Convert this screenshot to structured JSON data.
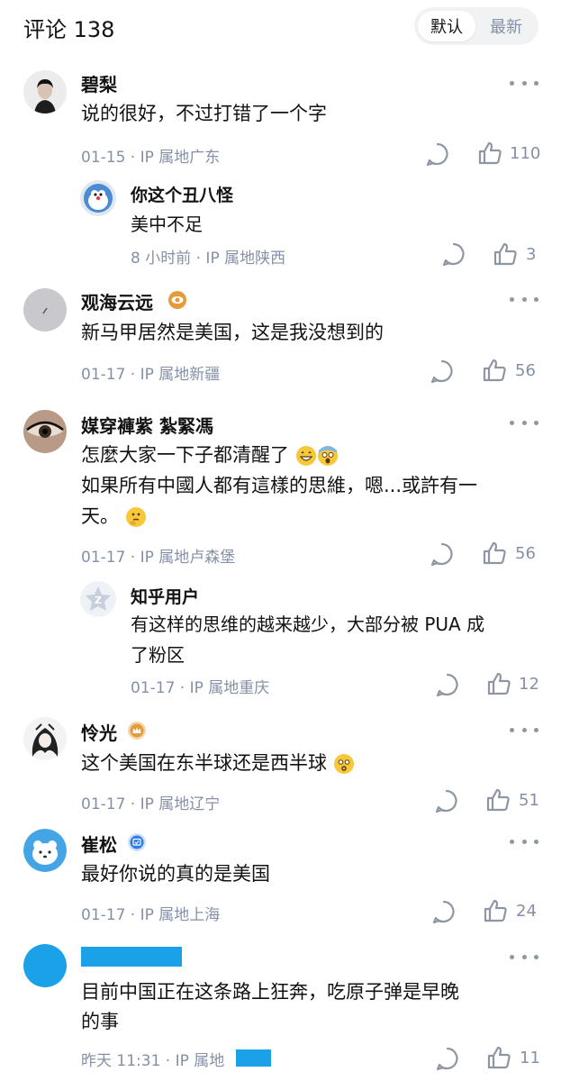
{
  "header": {
    "title": "评论 138",
    "sort_default": "默认",
    "sort_latest": "最新"
  },
  "colors": {
    "text_primary": "#121212",
    "text_secondary": "#8590a6",
    "redaction_blue": "#1ba1e8",
    "badge_orange": "#e59a3c",
    "badge_blue": "#2d7de6"
  },
  "comments": [
    {
      "name": "碧梨",
      "text": "说的很好，不过打错了一个字",
      "meta": "01-15 · IP 属地广东",
      "likes": "110"
    },
    {
      "name": "你这个丑八怪",
      "text": "美中不足",
      "meta": "8 小时前 · IP 属地陕西",
      "likes": "3"
    },
    {
      "name": "观海云远",
      "badge": "eye-badge-icon",
      "text": "新马甲居然是美国，这是我没想到的",
      "meta": "01-17 · IP 属地新疆",
      "likes": "56"
    },
    {
      "name": "媒穿褲紫 紮緊馮",
      "text_line1": "怎麼大家一下子都清醒了",
      "text_line2": "如果所有中國人都有這樣的思維，嗯...或許有一",
      "text_line3": "天。",
      "meta": "01-17 · IP 属地卢森堡",
      "likes": "56"
    },
    {
      "name": "知乎用户",
      "text_line1": "有这样的思维的越来越少，大部分被 PUA 成",
      "text_line2": "了粉区",
      "meta": "01-17 · IP 属地重庆",
      "likes": "12"
    },
    {
      "name": "怜光",
      "badge": "crown-badge-icon",
      "text": "这个美国在东半球还是西半球",
      "meta": "01-17 · IP 属地辽宁",
      "likes": "51"
    },
    {
      "name": "崔松",
      "badge": "verified-badge-icon",
      "text": "最好你说的真的是美国",
      "meta": "01-17 · IP 属地上海",
      "likes": "24"
    },
    {
      "text_line1": "目前中国正在这条路上狂奔，吃原子弹是早晚",
      "text_line2": "的事",
      "meta": "昨天 11:31 · IP 属地",
      "likes": "11"
    }
  ]
}
